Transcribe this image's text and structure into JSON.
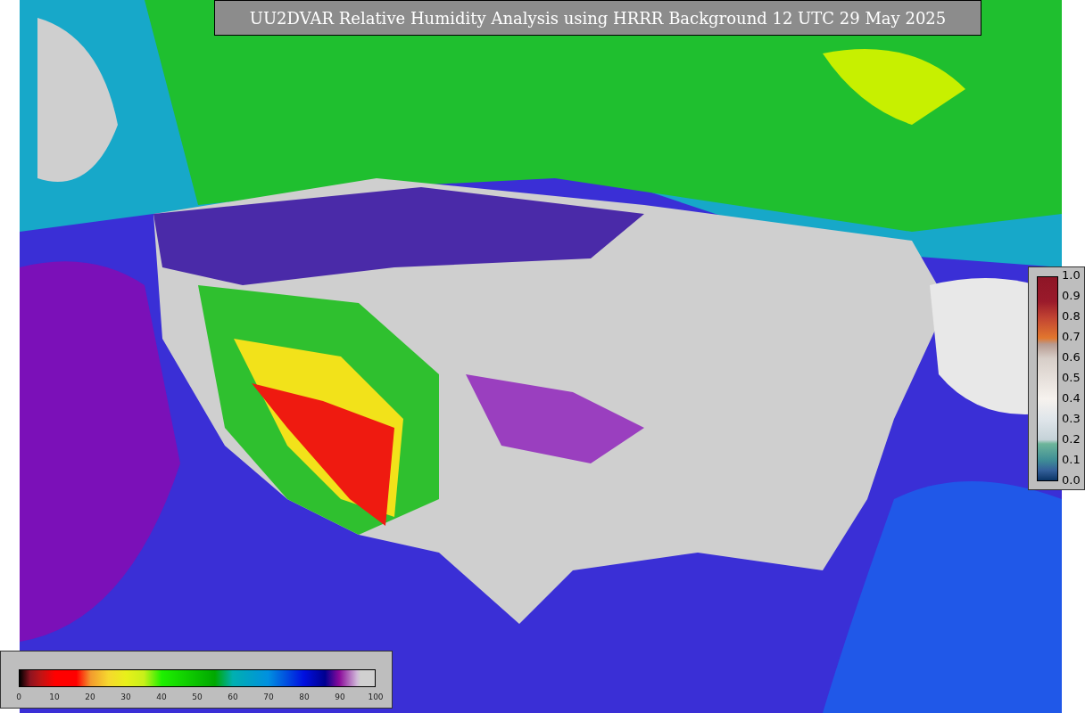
{
  "title": "UU2DVAR Relative Humidity Analysis using HRRR Background 12 UTC 29 May 2025",
  "observation_colorbar": {
    "ticks": [
      "1.0",
      "0.9",
      "0.8",
      "0.7",
      "0.6",
      "0.5",
      "0.4",
      "0.3",
      "0.2",
      "0.1",
      "0.0"
    ]
  },
  "humidity_colorbar": {
    "ticks": [
      "0",
      "10",
      "20",
      "30",
      "40",
      "50",
      "60",
      "70",
      "80",
      "90",
      "100"
    ]
  }
}
